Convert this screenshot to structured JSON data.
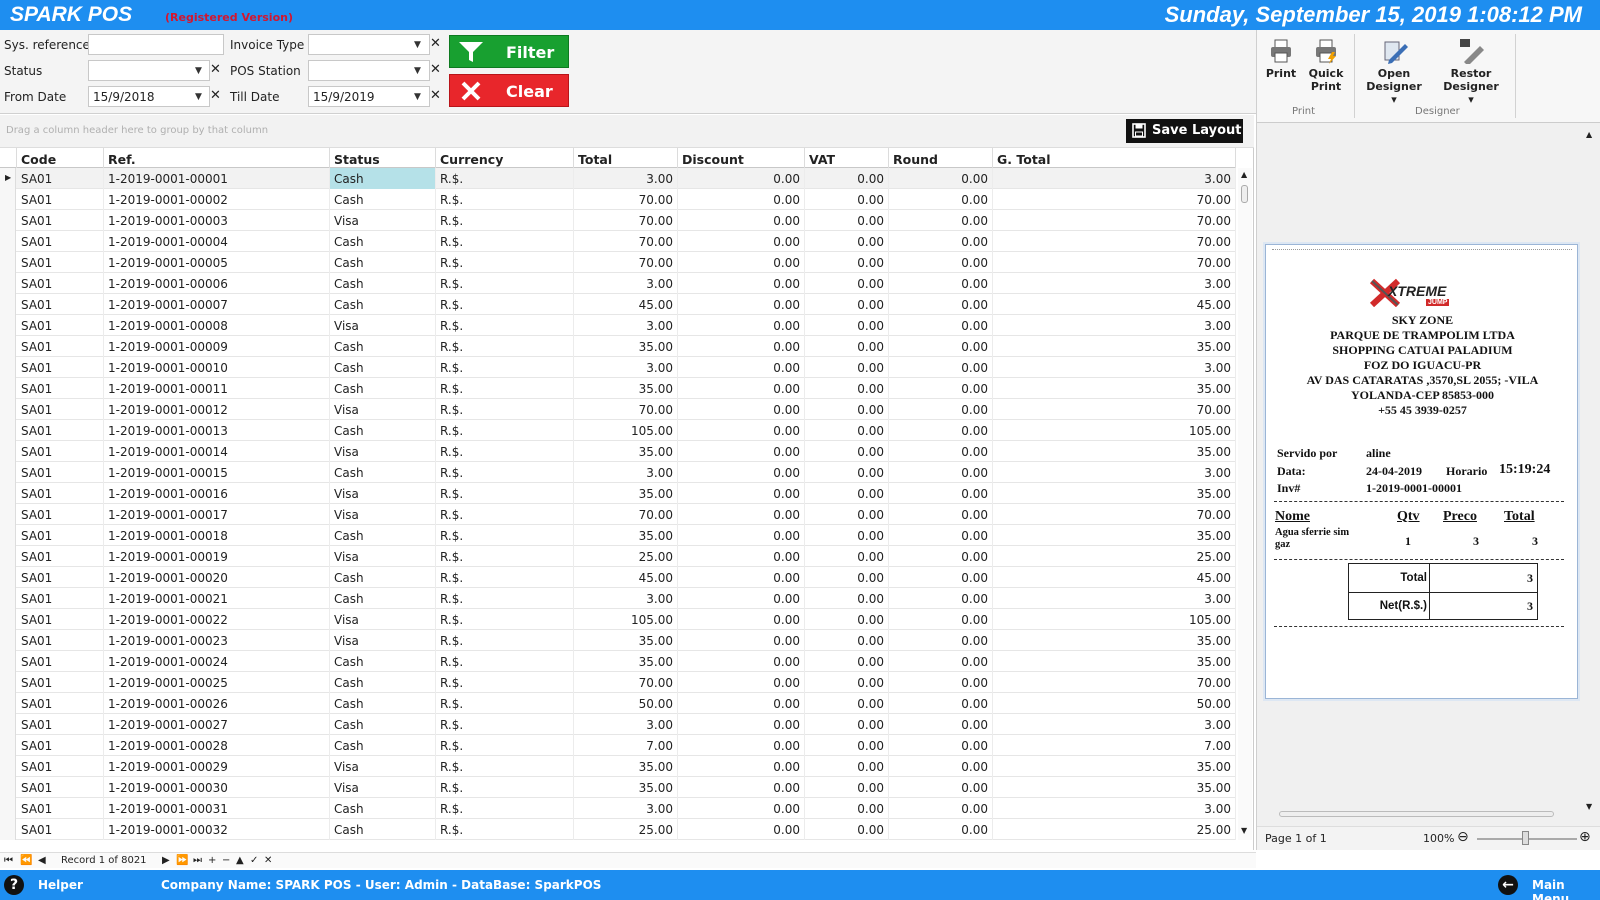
{
  "header": {
    "app_title": "SPARK POS",
    "registered": "(Registered Version)",
    "datetime": "Sunday, September 15, 2019 1:08:12 PM"
  },
  "filters": {
    "sys_reference_label": "Sys. reference",
    "sys_reference_value": "",
    "invoice_type_label": "Invoice Type",
    "invoice_type_value": "",
    "status_label": "Status",
    "status_value": "",
    "pos_station_label": "POS Station",
    "pos_station_value": "",
    "from_date_label": "From Date",
    "from_date_value": "15/9/2018",
    "till_date_label": "Till Date",
    "till_date_value": "15/9/2019",
    "filter_label": "Filter",
    "clear_label": "Clear"
  },
  "grid": {
    "group_hint": "Drag a column header here to group by that column",
    "save_layout_label": "Save Layout",
    "columns": [
      "Code",
      "Ref.",
      "Status",
      "Currency",
      "Total",
      "Discount",
      "VAT",
      "Round",
      "G. Total"
    ],
    "rows": [
      [
        "SA01",
        "1-2019-0001-00001",
        "Cash",
        "R.$.",
        "3.00",
        "0.00",
        "0.00",
        "0.00",
        "3.00"
      ],
      [
        "SA01",
        "1-2019-0001-00002",
        "Cash",
        "R.$.",
        "70.00",
        "0.00",
        "0.00",
        "0.00",
        "70.00"
      ],
      [
        "SA01",
        "1-2019-0001-00003",
        "Visa",
        "R.$.",
        "70.00",
        "0.00",
        "0.00",
        "0.00",
        "70.00"
      ],
      [
        "SA01",
        "1-2019-0001-00004",
        "Cash",
        "R.$.",
        "70.00",
        "0.00",
        "0.00",
        "0.00",
        "70.00"
      ],
      [
        "SA01",
        "1-2019-0001-00005",
        "Cash",
        "R.$.",
        "70.00",
        "0.00",
        "0.00",
        "0.00",
        "70.00"
      ],
      [
        "SA01",
        "1-2019-0001-00006",
        "Cash",
        "R.$.",
        "3.00",
        "0.00",
        "0.00",
        "0.00",
        "3.00"
      ],
      [
        "SA01",
        "1-2019-0001-00007",
        "Cash",
        "R.$.",
        "45.00",
        "0.00",
        "0.00",
        "0.00",
        "45.00"
      ],
      [
        "SA01",
        "1-2019-0001-00008",
        "Visa",
        "R.$.",
        "3.00",
        "0.00",
        "0.00",
        "0.00",
        "3.00"
      ],
      [
        "SA01",
        "1-2019-0001-00009",
        "Cash",
        "R.$.",
        "35.00",
        "0.00",
        "0.00",
        "0.00",
        "35.00"
      ],
      [
        "SA01",
        "1-2019-0001-00010",
        "Cash",
        "R.$.",
        "3.00",
        "0.00",
        "0.00",
        "0.00",
        "3.00"
      ],
      [
        "SA01",
        "1-2019-0001-00011",
        "Cash",
        "R.$.",
        "35.00",
        "0.00",
        "0.00",
        "0.00",
        "35.00"
      ],
      [
        "SA01",
        "1-2019-0001-00012",
        "Visa",
        "R.$.",
        "70.00",
        "0.00",
        "0.00",
        "0.00",
        "70.00"
      ],
      [
        "SA01",
        "1-2019-0001-00013",
        "Cash",
        "R.$.",
        "105.00",
        "0.00",
        "0.00",
        "0.00",
        "105.00"
      ],
      [
        "SA01",
        "1-2019-0001-00014",
        "Visa",
        "R.$.",
        "35.00",
        "0.00",
        "0.00",
        "0.00",
        "35.00"
      ],
      [
        "SA01",
        "1-2019-0001-00015",
        "Cash",
        "R.$.",
        "3.00",
        "0.00",
        "0.00",
        "0.00",
        "3.00"
      ],
      [
        "SA01",
        "1-2019-0001-00016",
        "Visa",
        "R.$.",
        "35.00",
        "0.00",
        "0.00",
        "0.00",
        "35.00"
      ],
      [
        "SA01",
        "1-2019-0001-00017",
        "Visa",
        "R.$.",
        "70.00",
        "0.00",
        "0.00",
        "0.00",
        "70.00"
      ],
      [
        "SA01",
        "1-2019-0001-00018",
        "Cash",
        "R.$.",
        "35.00",
        "0.00",
        "0.00",
        "0.00",
        "35.00"
      ],
      [
        "SA01",
        "1-2019-0001-00019",
        "Visa",
        "R.$.",
        "25.00",
        "0.00",
        "0.00",
        "0.00",
        "25.00"
      ],
      [
        "SA01",
        "1-2019-0001-00020",
        "Cash",
        "R.$.",
        "45.00",
        "0.00",
        "0.00",
        "0.00",
        "45.00"
      ],
      [
        "SA01",
        "1-2019-0001-00021",
        "Cash",
        "R.$.",
        "3.00",
        "0.00",
        "0.00",
        "0.00",
        "3.00"
      ],
      [
        "SA01",
        "1-2019-0001-00022",
        "Visa",
        "R.$.",
        "105.00",
        "0.00",
        "0.00",
        "0.00",
        "105.00"
      ],
      [
        "SA01",
        "1-2019-0001-00023",
        "Visa",
        "R.$.",
        "35.00",
        "0.00",
        "0.00",
        "0.00",
        "35.00"
      ],
      [
        "SA01",
        "1-2019-0001-00024",
        "Cash",
        "R.$.",
        "35.00",
        "0.00",
        "0.00",
        "0.00",
        "35.00"
      ],
      [
        "SA01",
        "1-2019-0001-00025",
        "Cash",
        "R.$.",
        "70.00",
        "0.00",
        "0.00",
        "0.00",
        "70.00"
      ],
      [
        "SA01",
        "1-2019-0001-00026",
        "Cash",
        "R.$.",
        "50.00",
        "0.00",
        "0.00",
        "0.00",
        "50.00"
      ],
      [
        "SA01",
        "1-2019-0001-00027",
        "Cash",
        "R.$.",
        "3.00",
        "0.00",
        "0.00",
        "0.00",
        "3.00"
      ],
      [
        "SA01",
        "1-2019-0001-00028",
        "Cash",
        "R.$.",
        "7.00",
        "0.00",
        "0.00",
        "0.00",
        "7.00"
      ],
      [
        "SA01",
        "1-2019-0001-00029",
        "Visa",
        "R.$.",
        "35.00",
        "0.00",
        "0.00",
        "0.00",
        "35.00"
      ],
      [
        "SA01",
        "1-2019-0001-00030",
        "Visa",
        "R.$.",
        "35.00",
        "0.00",
        "0.00",
        "0.00",
        "35.00"
      ],
      [
        "SA01",
        "1-2019-0001-00031",
        "Cash",
        "R.$.",
        "3.00",
        "0.00",
        "0.00",
        "0.00",
        "3.00"
      ],
      [
        "SA01",
        "1-2019-0001-00032",
        "Cash",
        "R.$.",
        "25.00",
        "0.00",
        "0.00",
        "0.00",
        "25.00"
      ]
    ],
    "record_label": "Record 1 of 8021"
  },
  "ribbon": {
    "print_label": "Print",
    "quick_print_label": "Quick Print",
    "open_designer_label": "Open Designer",
    "restor_designer_label": "Restor Designer",
    "group_print": "Print",
    "group_designer": "Designer"
  },
  "receipt": {
    "logo_text": "XTREME",
    "logo_sub": "JUMP",
    "lines": [
      "SKY ZONE",
      "PARQUE DE TRAMPOLIM LTDA",
      "SHOPPING CATUAI PALADIUM",
      "FOZ DO IGUACU-PR",
      "AV DAS CATARATAS ,3570,SL 2055; -VILA",
      "YOLANDA-CEP 85853-000",
      "+55 45 3939-0257"
    ],
    "servido_label": "Servido por",
    "servido_value": "aline",
    "data_label": "Data:",
    "data_value": "24-04-2019",
    "horario_label": "Horario",
    "horario_value": "15:19:24",
    "inv_label": "Inv#",
    "inv_value": "1-2019-0001-00001",
    "col_nome": "Nome",
    "col_qtv": "Qtv",
    "col_preco": "Preco",
    "col_total": "Total",
    "item_name": "Agua sferrie sim gaz",
    "item_qty": "1",
    "item_price": "3",
    "item_total": "3",
    "total_label": "Total",
    "total_value": "3",
    "net_label": "Net(R.$.)",
    "net_value": "3"
  },
  "preview_status": {
    "page": "Page 1 of 1",
    "zoom": "100%"
  },
  "footer": {
    "helper": "Helper",
    "company": "Company Name: SPARK POS - User: Admin - DataBase: SparkPOS",
    "main_menu": "Main Menu"
  },
  "colors": {
    "bar_blue": "#1e8ef0",
    "filter_green": "#18a030",
    "clear_red": "#e8262b",
    "selected_status": "#b5e1e8"
  }
}
